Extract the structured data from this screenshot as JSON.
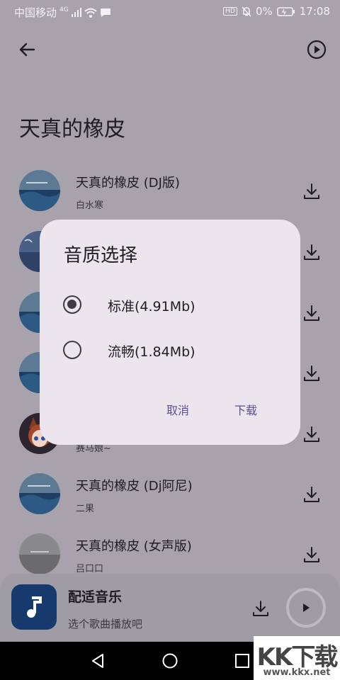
{
  "status_bar": {
    "carrier": "中国移动",
    "network": "4G",
    "hd": "HD",
    "battery": "0%",
    "time": "17:08"
  },
  "page": {
    "title": "天真的橡皮"
  },
  "songs": [
    {
      "title": "天真的橡皮 (DJ版)",
      "artist": "白水寒",
      "cover": "ocean-cover"
    },
    {
      "title": "",
      "artist": "",
      "cover": "night-cover"
    },
    {
      "title": "",
      "artist": "",
      "cover": "ocean-cover"
    },
    {
      "title": "",
      "artist": "",
      "cover": "ocean-cover"
    },
    {
      "title": "",
      "artist": "赛马娘~",
      "cover": "anime-cover"
    },
    {
      "title": "天真的橡皮 (Dj阿尼)",
      "artist": "二果",
      "cover": "ocean-cover"
    },
    {
      "title": "天真的橡皮 (女声版)",
      "artist": "吕口口",
      "cover": "gray-cover"
    }
  ],
  "player": {
    "title": "配适音乐",
    "subtitle": "选个歌曲播放吧"
  },
  "dialog": {
    "title": "音质选择",
    "options": [
      {
        "label": "标准(4.91Mb)",
        "selected": true
      },
      {
        "label": "流畅(1.84Mb)",
        "selected": false
      }
    ],
    "cancel_label": "取消",
    "confirm_label": "下载"
  },
  "watermark": {
    "text": "KK下载",
    "url": "www.kkx.net"
  },
  "colors": {
    "scrim_bg": "#a7a2ab",
    "dialog_bg": "#ebe6ee",
    "accent": "#5b4f96",
    "player_cover": "#163a6e"
  }
}
